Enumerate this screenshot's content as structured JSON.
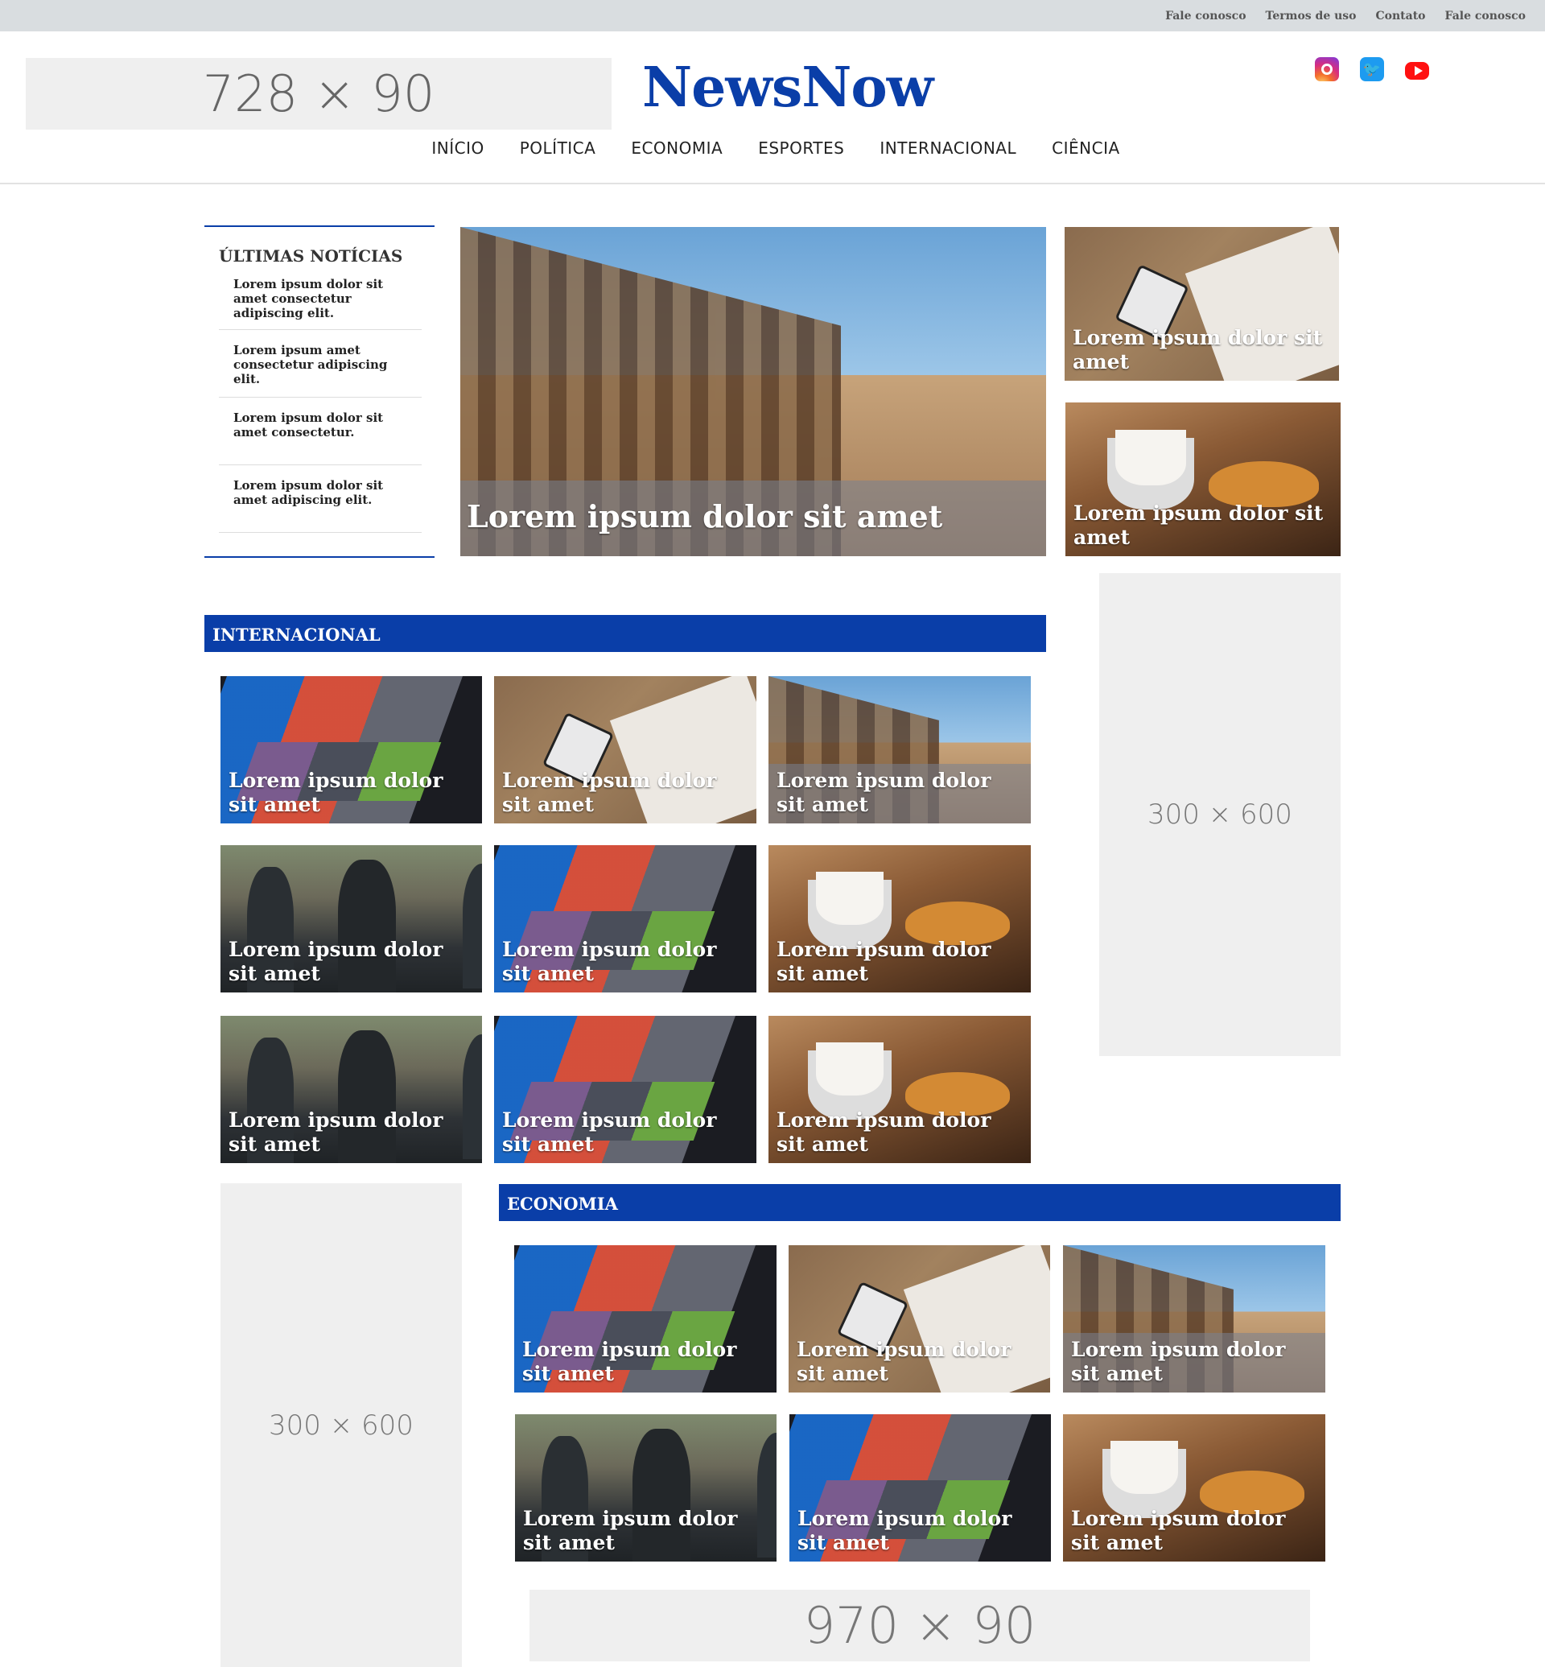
{
  "topbar": {
    "links": [
      "Fale conosco",
      "Termos de uso",
      "Contato",
      "Fale conosco"
    ]
  },
  "header": {
    "ad_label": "728 × 90",
    "logo": "NewsNow",
    "social": [
      "instagram-icon",
      "twitter-icon",
      "youtube-icon"
    ],
    "nav": [
      "INÍCIO",
      "POLÍTICA",
      "ECONOMIA",
      "ESPORTES",
      "INTERNACIONAL",
      "CIÊNCIA"
    ]
  },
  "latest": {
    "title": "ÚLTIMAS NOTÍCIAS",
    "items": [
      "Lorem ipsum dolor sit amet consectetur adipiscing elit.",
      "Lorem ipsum amet consectetur adipiscing elit.",
      "Lorem ipsum dolor sit amet consectetur.",
      "Lorem ipsum dolor sit amet adipiscing elit."
    ]
  },
  "featured": {
    "title": "Lorem ipsum dolor sit amet"
  },
  "side_cards": [
    "Lorem ipsum dolor sit amet",
    "Lorem ipsum dolor sit amet"
  ],
  "ads": {
    "sky1": "300 × 600",
    "sky2": "300 × 600",
    "leader": "970 × 90"
  },
  "internacional": {
    "title": "INTERNACIONAL",
    "cards": [
      "Lorem ipsum dolor sit amet",
      "Lorem ipsum dolor sit amet",
      "Lorem ipsum dolor sit amet",
      "Lorem ipsum dolor sit amet",
      "Lorem ipsum dolor sit amet",
      "Lorem ipsum dolor sit amet",
      "Lorem ipsum dolor sit amet",
      "Lorem ipsum dolor sit amet",
      "Lorem ipsum dolor sit amet"
    ]
  },
  "economia": {
    "title": "ECONOMIA",
    "cards": [
      "Lorem ipsum dolor sit amet",
      "Lorem ipsum dolor sit amet",
      "Lorem ipsum dolor sit amet",
      "Lorem ipsum dolor sit amet",
      "Lorem ipsum dolor sit amet",
      "Lorem ipsum dolor sit amet"
    ]
  },
  "colors": {
    "brand": "#0a3ea8",
    "topbar": "#d9dde0",
    "ad_bg": "#efefef"
  }
}
